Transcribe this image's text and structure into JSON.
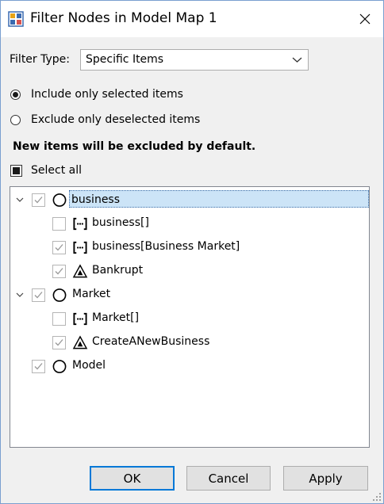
{
  "window": {
    "title": "Filter Nodes in Model Map 1",
    "app_icon": "app-icon",
    "close_icon": "close-icon"
  },
  "filter_type": {
    "label": "Filter Type:",
    "value": "Specific Items"
  },
  "options": {
    "include_label": "Include only selected items",
    "include_selected": true,
    "exclude_label": "Exclude only deselected items",
    "exclude_selected": false
  },
  "notice": "New items will be excluded by default.",
  "select_all": {
    "label": "Select all",
    "state": "indeterminate"
  },
  "tree": {
    "nodes": [
      {
        "label": "business",
        "icon": "circle-icon",
        "checked": true,
        "expanded": true,
        "depth": 0,
        "selected": true
      },
      {
        "label": "business[]",
        "icon": "bracket-icon",
        "checked": false,
        "depth": 1
      },
      {
        "label": "business[Business Market]",
        "icon": "bracket-icon",
        "checked": true,
        "depth": 1
      },
      {
        "label": "Bankrupt",
        "icon": "triangle-icon",
        "checked": true,
        "depth": 1
      },
      {
        "label": "Market",
        "icon": "circle-icon",
        "checked": true,
        "expanded": true,
        "depth": 0
      },
      {
        "label": "Market[]",
        "icon": "bracket-icon",
        "checked": false,
        "depth": 1
      },
      {
        "label": "CreateANewBusiness",
        "icon": "triangle-icon",
        "checked": true,
        "depth": 1
      },
      {
        "label": "Model",
        "icon": "circle-icon",
        "checked": true,
        "depth": 0
      }
    ]
  },
  "buttons": {
    "ok": "OK",
    "cancel": "Cancel",
    "apply": "Apply"
  },
  "colors": {
    "accent": "#0078d7",
    "selection": "#cce4f7"
  }
}
